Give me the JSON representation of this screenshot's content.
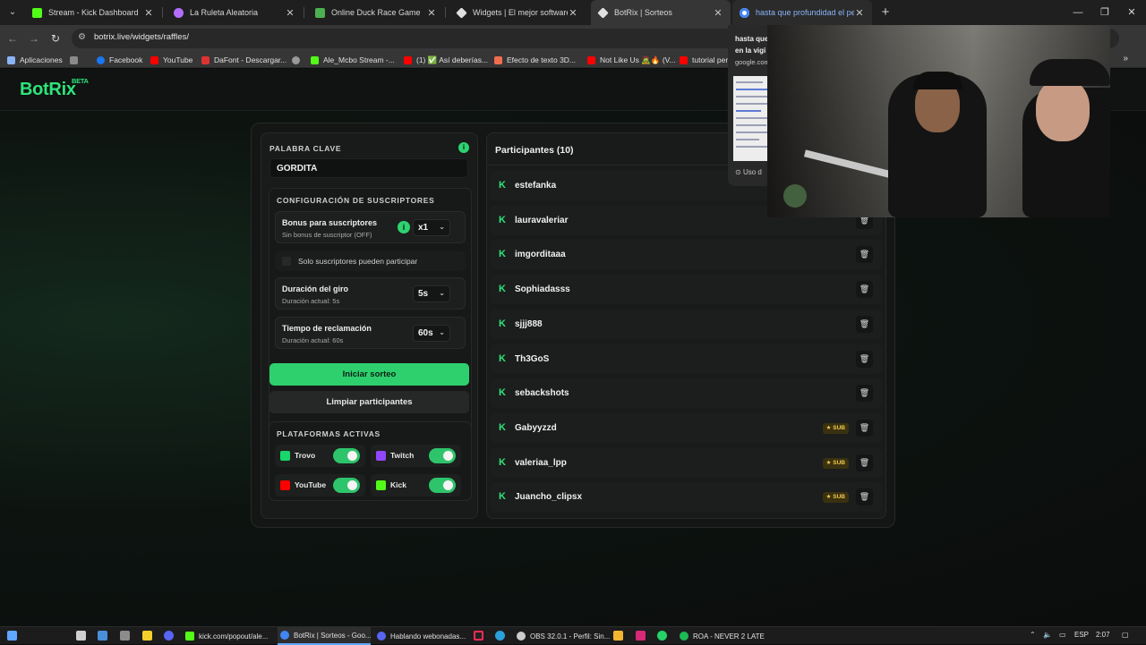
{
  "browser": {
    "tabs": [
      {
        "title": "Stream - Kick Dashboard",
        "color": "#53fc18"
      },
      {
        "title": "La Ruleta Aleatoria",
        "color": "#b56dff"
      },
      {
        "title": "Online Duck Race Game",
        "color": "#4caf50"
      },
      {
        "title": "Widgets | El mejor software pa",
        "color": "#e0e0e0"
      },
      {
        "title": "BotRix | Sorteos",
        "color": "#e0e0e0"
      },
      {
        "title": "hasta que profundidad el pene",
        "color": "#4285f4"
      }
    ],
    "url": "botrix.live/widgets/raffles/",
    "bookmarks": [
      {
        "label": "Aplicaciones",
        "color": "#8ab4f8"
      },
      {
        "label": "Facebook",
        "color": "#1877f2"
      },
      {
        "label": "YouTube",
        "color": "#ff0000"
      },
      {
        "label": "DaFont - Descargar...",
        "color": "#d33"
      },
      {
        "label": "Ale_Mcbo Stream -...",
        "color": "#53fc18"
      },
      {
        "label": "(1) ✅ Así deberías...",
        "color": "#ff0000"
      },
      {
        "label": "Efecto de texto 3D...",
        "color": "#f06d4f"
      },
      {
        "label": "Not Like Us 🧟🔥 (V...",
        "color": "#ff0000"
      },
      {
        "label": "tutorial per",
        "color": "#ff0000"
      }
    ]
  },
  "preview": {
    "title": "hasta que profundidad el pene en la vigilia",
    "line1": "hasta que",
    "line2": "en la vigi",
    "host": "google.com",
    "usage": "Uso d"
  },
  "app": {
    "logo": "BotRix",
    "beta": "BETA",
    "accent": "#2ee57a"
  },
  "raffle": {
    "keyword_label": "PALABRA CLAVE",
    "keyword_value": "GORDITA",
    "subs_section_label": "CONFIGURACIÓN DE SUSCRIPTORES",
    "sub_bonus": {
      "title": "Bonus para suscriptores",
      "subtitle": "Sin bonus de suscriptor (OFF)",
      "value": "x1"
    },
    "subs_only_label": "Solo suscriptores pueden participar",
    "spin_duration": {
      "title": "Duración del giro",
      "subtitle": "Duración actual: 5s",
      "value": "5s"
    },
    "claim_time": {
      "title": "Tiempo de reclamación",
      "subtitle": "Duración actual: 60s",
      "value": "60s"
    },
    "start_button": "Iniciar sorteo",
    "clear_button": "Limpiar participantes",
    "platforms_label": "PLATAFORMAS ACTIVAS",
    "platforms": [
      {
        "name": "Trovo",
        "enabled": true,
        "color": "#19d66b"
      },
      {
        "name": "Twitch",
        "enabled": true,
        "color": "#9146ff"
      },
      {
        "name": "YouTube",
        "enabled": true,
        "color": "#ff0000"
      },
      {
        "name": "Kick",
        "enabled": true,
        "color": "#53fc18"
      }
    ]
  },
  "participants": {
    "title": "Participantes (10)",
    "sub_badge": "SUB",
    "list": [
      {
        "name": "estefanka",
        "sub": false
      },
      {
        "name": "lauravaleriar",
        "sub": false
      },
      {
        "name": "imgorditaaa",
        "sub": false
      },
      {
        "name": "Sophiadasss",
        "sub": false
      },
      {
        "name": "sjjj888",
        "sub": false
      },
      {
        "name": "Th3GoS",
        "sub": false
      },
      {
        "name": "sebackshots",
        "sub": false
      },
      {
        "name": "Gabyyzzd",
        "sub": true
      },
      {
        "name": "valeriaa_lpp",
        "sub": true
      },
      {
        "name": "Juancho_clipsx",
        "sub": true
      }
    ]
  },
  "taskbar": {
    "apps": [
      {
        "label": "kick.com/popout/ale...",
        "color": "#53fc18"
      },
      {
        "label": "BotRix | Sorteos - Goo...",
        "color": "#4285f4"
      },
      {
        "label": "Hablando webonadas...",
        "color": "#5865f2"
      },
      {
        "label": "OBS 32.0.1 - Perfil: Sin...",
        "color": "#cccccc"
      },
      {
        "label": "ROA - NEVER 2 LATE",
        "color": "#1db954"
      }
    ],
    "lang": "ESP",
    "time": "2:07"
  }
}
